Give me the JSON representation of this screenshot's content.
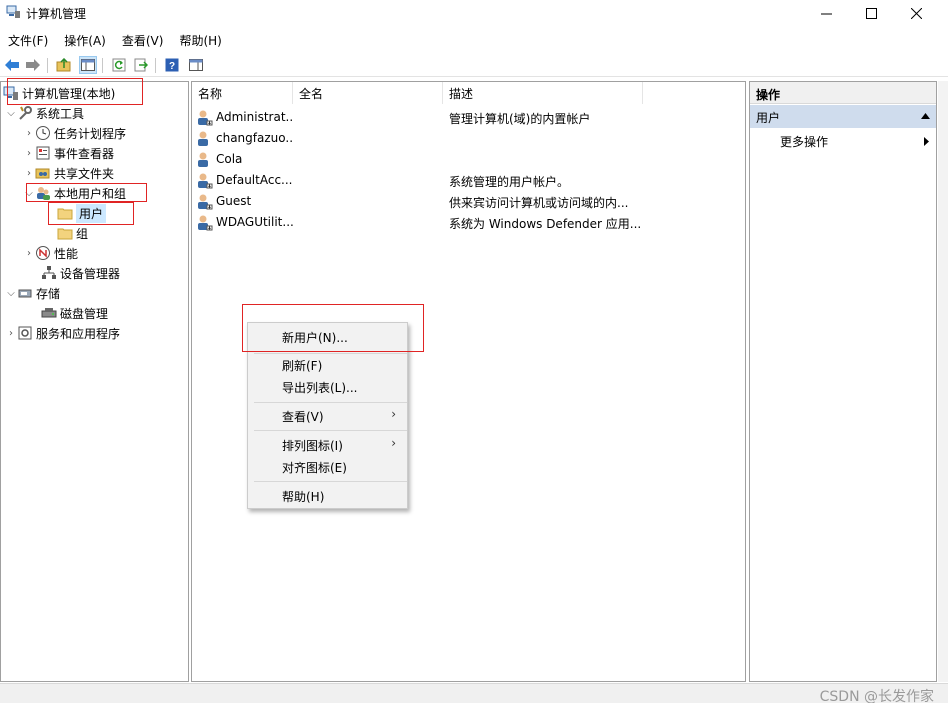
{
  "window": {
    "title": "计算机管理"
  },
  "menubar": [
    "文件(F)",
    "操作(A)",
    "查看(V)",
    "帮助(H)"
  ],
  "tree": {
    "root": "计算机管理(本地)",
    "system_tools": "系统工具",
    "task_scheduler": "任务计划程序",
    "event_viewer": "事件查看器",
    "shared_folders": "共享文件夹",
    "local_users_groups": "本地用户和组",
    "users": "用户",
    "groups": "组",
    "performance": "性能",
    "device_manager": "设备管理器",
    "storage": "存储",
    "disk_management": "磁盘管理",
    "services_apps": "服务和应用程序"
  },
  "list": {
    "columns": [
      "名称",
      "全名",
      "描述"
    ],
    "rows": [
      {
        "name": "Administrat...",
        "fullname": "",
        "desc": "管理计算机(域)的内置帐户"
      },
      {
        "name": "changfazuo...",
        "fullname": "",
        "desc": ""
      },
      {
        "name": "Cola",
        "fullname": "",
        "desc": ""
      },
      {
        "name": "DefaultAcc...",
        "fullname": "",
        "desc": "系统管理的用户帐户。"
      },
      {
        "name": "Guest",
        "fullname": "",
        "desc": "供来宾访问计算机或访问域的内..."
      },
      {
        "name": "WDAGUtilit...",
        "fullname": "",
        "desc": "系统为 Windows Defender 应用..."
      }
    ]
  },
  "actions": {
    "header": "操作",
    "section": "用户",
    "more": "更多操作"
  },
  "context_menu": {
    "new_user": "新用户(N)...",
    "refresh": "刷新(F)",
    "export": "导出列表(L)...",
    "view": "查看(V)",
    "arrange": "排列图标(I)",
    "align": "对齐图标(E)",
    "help": "帮助(H)"
  },
  "watermark": "CSDN @长发作家",
  "colors": {
    "highlight_box": "#e02424",
    "selection": "#cce8ff",
    "action_section": "#cfdced"
  }
}
